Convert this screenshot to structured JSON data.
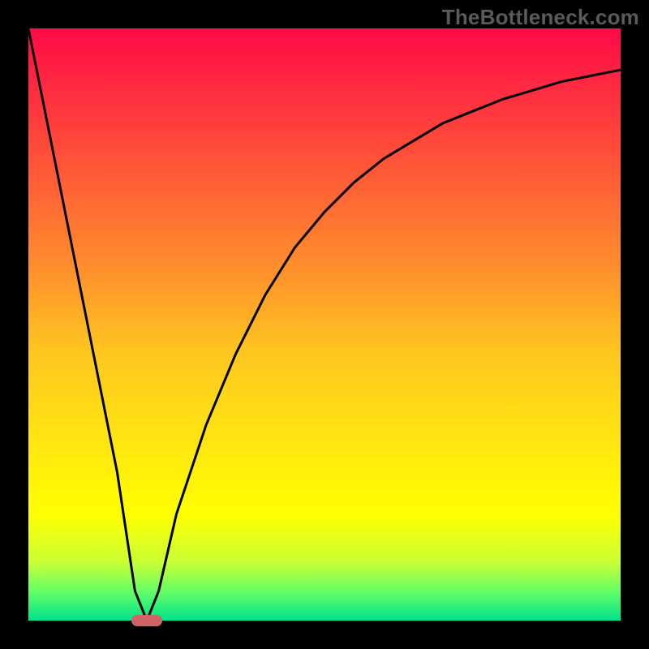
{
  "watermark": "TheBottleneck.com",
  "chart_data": {
    "type": "line",
    "title": "",
    "xlabel": "",
    "ylabel": "",
    "xlim": [
      0,
      100
    ],
    "ylim": [
      0,
      100
    ],
    "x": [
      0,
      5,
      10,
      15,
      18,
      20,
      22,
      25,
      30,
      35,
      40,
      45,
      50,
      55,
      60,
      65,
      70,
      75,
      80,
      85,
      90,
      95,
      100
    ],
    "values": [
      100,
      75,
      50,
      25,
      5,
      0,
      5,
      18,
      33,
      45,
      55,
      63,
      69,
      74,
      78,
      81,
      84,
      86,
      88,
      89.5,
      91,
      92,
      93
    ],
    "marker": {
      "x": 20,
      "y": 0
    },
    "grid": false
  },
  "colors": {
    "curve": "#000000",
    "marker": "#d06464"
  }
}
